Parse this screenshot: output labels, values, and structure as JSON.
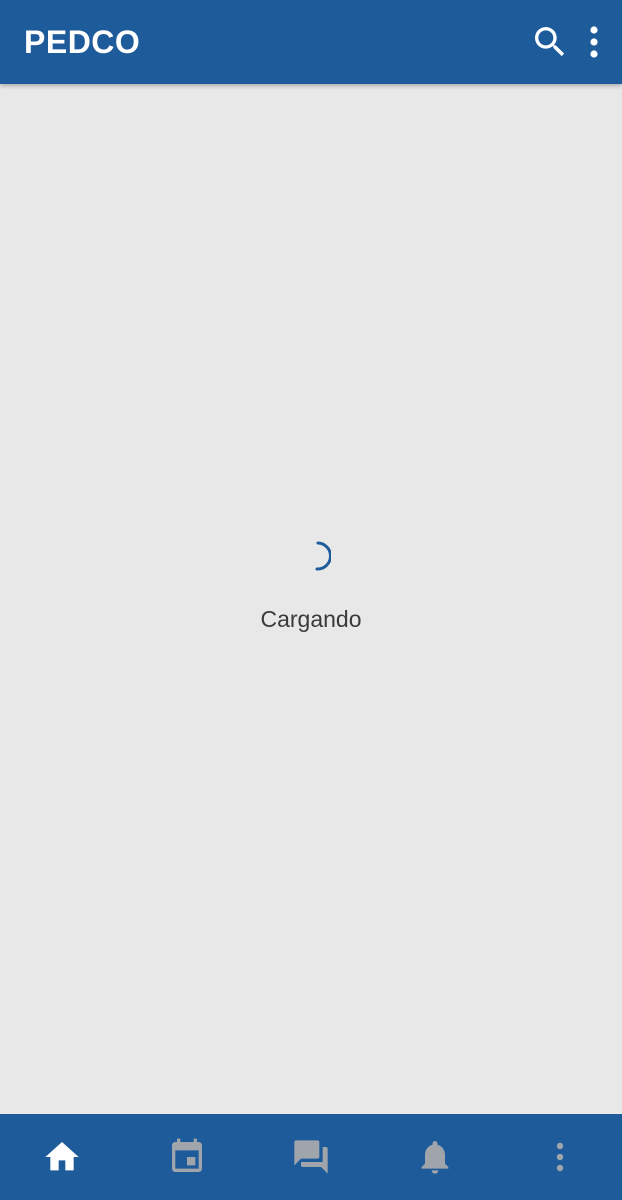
{
  "app_bar": {
    "title": "PEDCO",
    "background": "#1d5b9b",
    "actions": [
      {
        "name": "search",
        "icon": "search-icon"
      },
      {
        "name": "more",
        "icon": "more-vert-icon"
      }
    ]
  },
  "main": {
    "loading_text": "Cargando",
    "spinner_color": "#1d5b9b"
  },
  "bottom_nav": {
    "active_color": "#ffffff",
    "inactive_color": "#a0a4ab",
    "items": [
      {
        "name": "home",
        "icon": "home-icon",
        "active": true
      },
      {
        "name": "calendar",
        "icon": "calendar-icon",
        "active": false
      },
      {
        "name": "messages",
        "icon": "chat-icon",
        "active": false
      },
      {
        "name": "notifications",
        "icon": "bell-icon",
        "active": false
      },
      {
        "name": "more",
        "icon": "more-vert-icon",
        "active": false
      }
    ]
  }
}
